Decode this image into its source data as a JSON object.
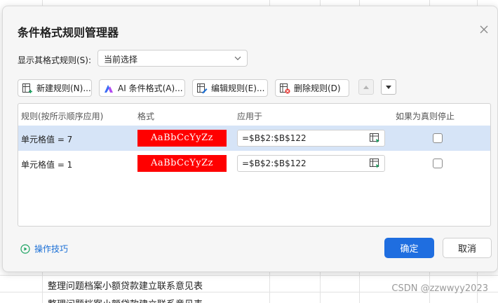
{
  "dialog": {
    "title": "条件格式规则管理器",
    "show_label": "显示其格式规则(S):",
    "show_value": "当前选择"
  },
  "toolbar": {
    "new_rule": "新建规则(N)...",
    "ai_format": "AI 条件格式(A)...",
    "edit_rule": "编辑规则(E)...",
    "delete_rule": "删除规则(D)"
  },
  "table": {
    "headers": [
      "规则(按所示顺序应用)",
      "格式",
      "应用于",
      "如果为真则停止"
    ],
    "rows": [
      {
        "condition": "单元格值 = 7",
        "format_preview": "AaBbCcYyZz",
        "applies_to": "=$B$2:$B$122",
        "stop_if_true": false,
        "selected": true
      },
      {
        "condition": "单元格值 = 1",
        "format_preview": "AaBbCcYyZz",
        "applies_to": "=$B$2:$B$122",
        "stop_if_true": false,
        "selected": false
      }
    ]
  },
  "footer": {
    "tips": "操作技巧",
    "ok": "确定",
    "cancel": "取消"
  },
  "background": {
    "row_text": "整理问题档案小额贷款建立联系意见表",
    "watermark": "CSDN @zzwwyy2023"
  },
  "colors": {
    "format_fill": "#ff0000",
    "format_text": "#ffffff",
    "primary": "#1f6ee0",
    "selected_row": "#d6e4f7",
    "link": "#1a6fd6"
  },
  "icons": {
    "close": "close-icon",
    "new_rule": "new-rule-icon",
    "ai": "ai-icon",
    "edit": "edit-rule-icon",
    "delete": "delete-rule-icon",
    "move_up": "triangle-up-icon",
    "move_down": "triangle-down-icon",
    "range_picker": "range-picker-icon",
    "tips": "play-circle-icon"
  }
}
